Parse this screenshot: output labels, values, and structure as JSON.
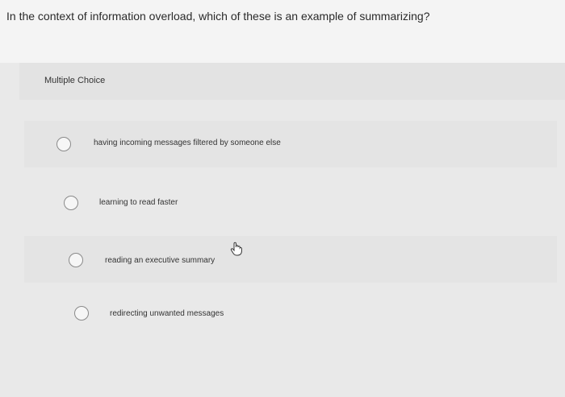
{
  "question": {
    "text": "In the context of information overload, which of these is an example of summarizing?"
  },
  "question_type": {
    "label": "Multiple Choice"
  },
  "options": [
    {
      "label": "having incoming messages filtered by someone else",
      "selected": false
    },
    {
      "label": "learning to read faster",
      "selected": false
    },
    {
      "label": "reading an executive summary",
      "selected": false
    },
    {
      "label": "redirecting unwanted messages",
      "selected": false
    }
  ],
  "pointer": {
    "icon": "hand-cursor-icon"
  }
}
